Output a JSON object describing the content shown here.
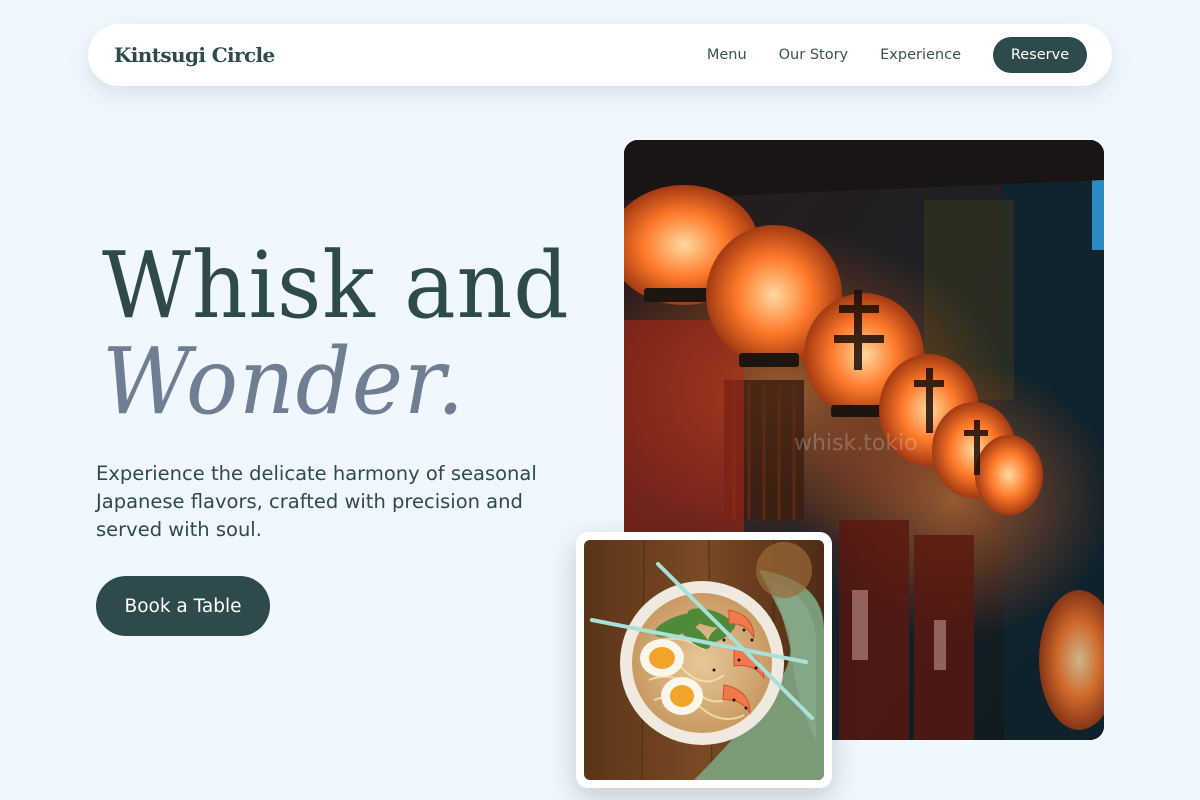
{
  "header": {
    "brand": "Kintsugi Circle",
    "nav": [
      "Menu",
      "Our Story",
      "Experience"
    ],
    "reserve_label": "Reserve"
  },
  "hero": {
    "title_line1": "Whisk and",
    "title_line2": "Wonder.",
    "subtitle": "Experience the delicate harmony of seasonal Japanese flavors, crafted with precision and served with soul.",
    "cta_label": "Book a Table"
  },
  "images": {
    "lantern_watermark": "whisk.tokio"
  },
  "colors": {
    "background": "#f0f7ff",
    "primary": "#2e4a4c",
    "accent_text": "#6f7e92"
  }
}
